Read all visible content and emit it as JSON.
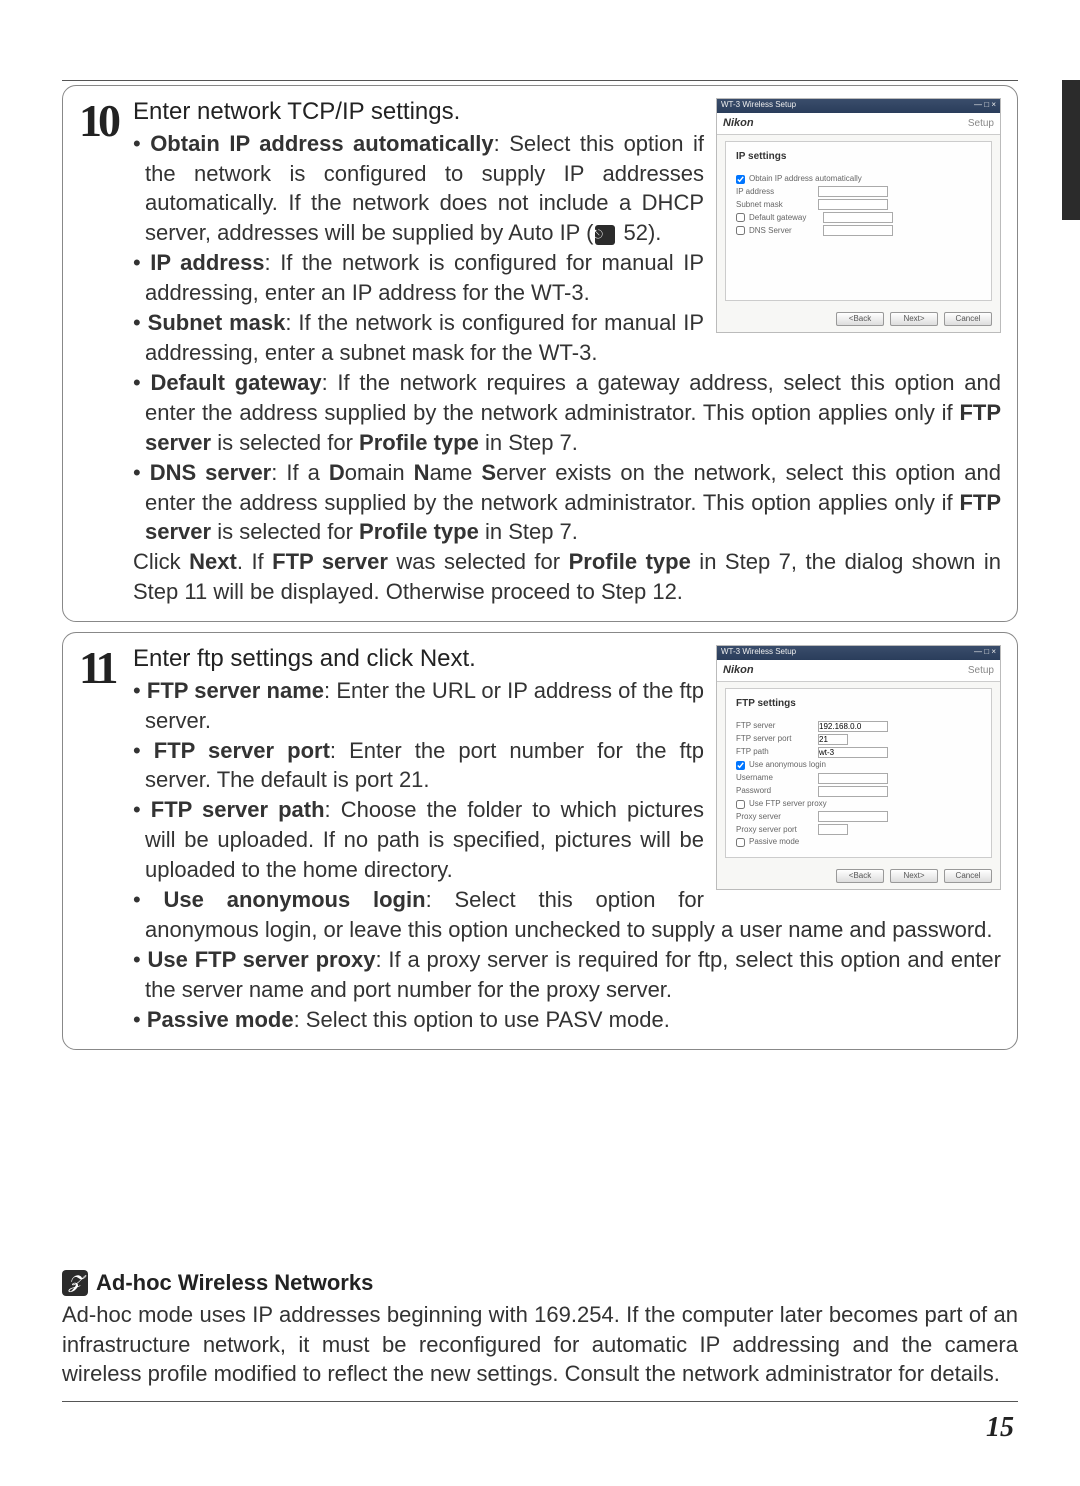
{
  "steps": {
    "s10": {
      "num": "10",
      "lead": "Enter network TCP/IP settings.",
      "items": {
        "obtain_label": "Obtain IP address automatically",
        "obtain_text": ": Select this option if the network is configured to supply IP addresses automatically.  If the network does not include a DHCP server, addresses will be supplied by Auto IP (",
        "obtain_pageref": " 52).",
        "ip_label": "IP address",
        "ip_text": ": If the network is configured for manual IP addressing, enter an IP address for the WT-3.",
        "subnet_label": "Subnet mask",
        "subnet_text": ": If the network is configured for manual IP addressing, enter a subnet mask for the WT-3.",
        "gateway_label": "Default gateway",
        "gateway_text": ": If the network requires a gateway address, select this option and enter the address supplied by the network administrator.  This option applies only if ",
        "gateway_tail_bold1": "FTP server",
        "gateway_tail_mid": " is selected for ",
        "gateway_tail_bold2": "Profile type",
        "gateway_tail_end": " in Step 7.",
        "dns_label": "DNS server",
        "dns_text_a": ": If a ",
        "dns_D": "D",
        "dns_text_b": "omain ",
        "dns_N": "N",
        "dns_text_c": "ame ",
        "dns_S": "S",
        "dns_text_d": "erver exists on the network, select this option and enter the address supplied by the network administrator.  This option applies only if ",
        "dns_tail_bold1": "FTP server",
        "dns_tail_mid": " is selected for ",
        "dns_tail_bold2": "Profile type",
        "dns_tail_end": " in Step 7."
      },
      "after_a": "Click ",
      "after_b": "Next",
      "after_c": ".  If ",
      "after_d": "FTP server",
      "after_e": " was selected for ",
      "after_f": "Profile type",
      "after_g": " in Step 7, the dialog shown in Step 11 will be displayed.  Otherwise proceed to Step 12."
    },
    "s11": {
      "num": "11",
      "lead_a": "Enter ftp settings and click ",
      "lead_b": "Next",
      "lead_c": ".",
      "items": {
        "name_label": "FTP server name",
        "name_text": ": Enter the URL or IP address of the ftp server.",
        "port_label": "FTP server port",
        "port_text": ": Enter the port number for the ftp server. The default is port 21.",
        "path_label": "FTP server path",
        "path_text": ": Choose the folder to which pictures will be uploaded.  If no path is specified, pictures will be uploaded to the home directory.",
        "anon_label": "Use anonymous login",
        "anon_text": ": Select this option for anonymous login, or leave this option unchecked to supply a user name and password.",
        "proxy_label": "Use FTP server proxy",
        "proxy_text": ": If a proxy server is required for ftp, select this option and enter the server name and port number for the proxy server.",
        "passive_label": "Passive mode",
        "passive_text": ": Select this option to use PASV mode."
      }
    }
  },
  "dialog10": {
    "title": "WT-3 Wireless Setup",
    "brand": "Nikon",
    "setup": "Setup",
    "heading": "IP settings",
    "ck_obtain": "Obtain IP address automatically",
    "lab_ip": "IP address",
    "lab_sub": "Subnet mask",
    "lab_gw": "Default gateway",
    "lab_dns": "DNS Server",
    "btn_back": "<Back",
    "btn_next": "Next>",
    "btn_cancel": "Cancel"
  },
  "dialog11": {
    "title": "WT-3 Wireless Setup",
    "brand": "Nikon",
    "setup": "Setup",
    "heading": "FTP settings",
    "lab_server": "FTP server",
    "val_server": "192.168.0.0",
    "lab_port": "FTP server port",
    "val_port": "21",
    "lab_path": "FTP path",
    "val_path": "wt-3",
    "lab_anon": "Use anonymous login",
    "lab_user": "Username",
    "lab_pass": "Password",
    "lab_proxy": "Use FTP server proxy",
    "lab_pserver": "Proxy server",
    "lab_pport": "Proxy server port",
    "lab_passive": "Passive mode",
    "btn_back": "<Back",
    "btn_next": "Next>",
    "btn_cancel": "Cancel"
  },
  "note": {
    "heading": "Ad-hoc Wireless Networks",
    "body": "Ad-hoc mode uses IP addresses beginning with 169.254.  If the computer later becomes part of an infrastructure network, it must be reconfigured for automatic IP addressing and the camera wireless profile modified to reflect the new settings.  Consult the network administrator for details."
  },
  "page_number": "15"
}
